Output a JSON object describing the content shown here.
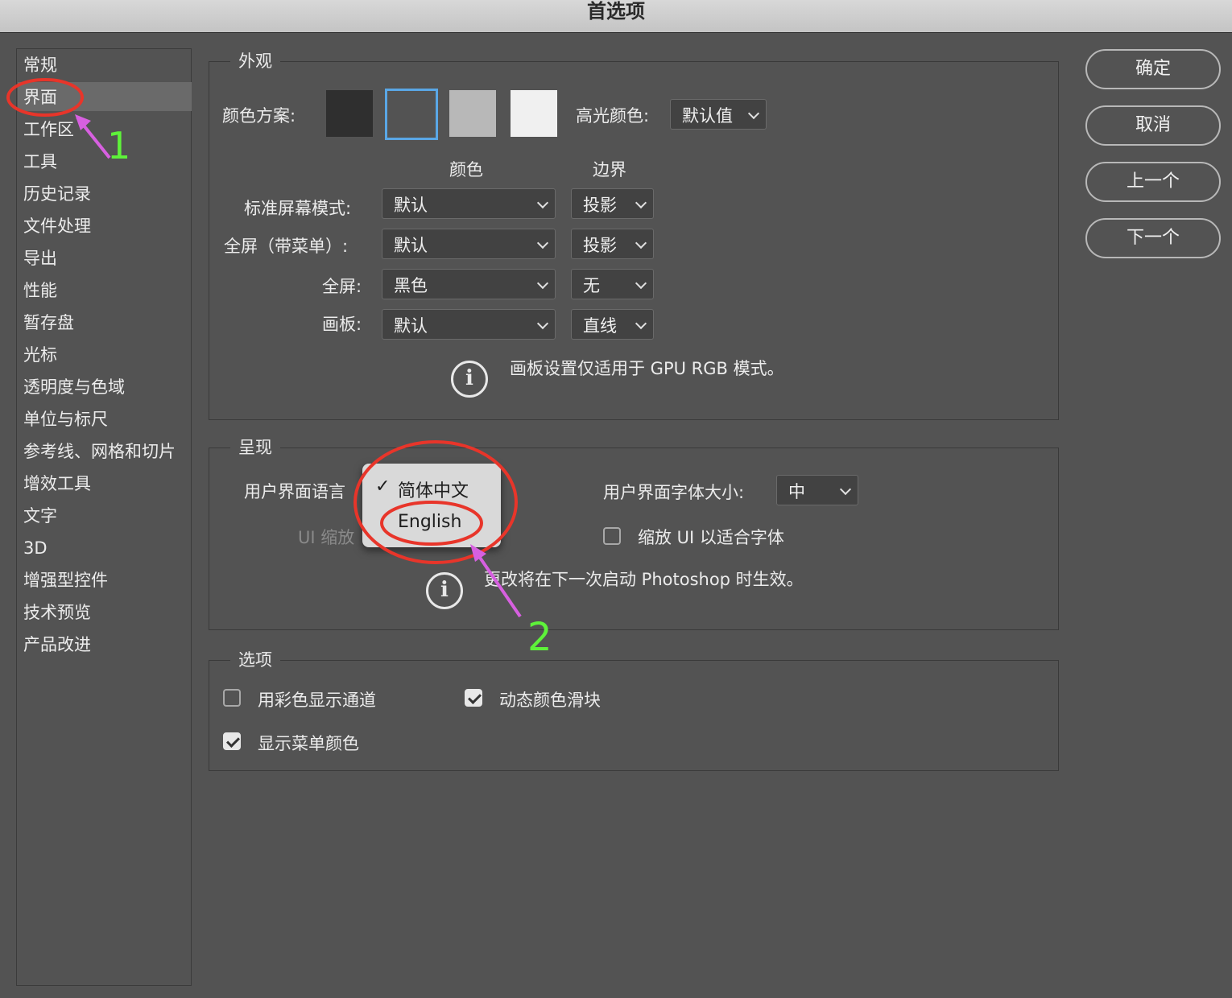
{
  "window": {
    "title": "首选项"
  },
  "sidebar": {
    "selected_index": 1,
    "items": [
      "常规",
      "界面",
      "工作区",
      "工具",
      "历史记录",
      "文件处理",
      "导出",
      "性能",
      "暂存盘",
      "光标",
      "透明度与色域",
      "单位与标尺",
      "参考线、网格和切片",
      "增效工具",
      "文字",
      "3D",
      "增强型控件",
      "技术预览",
      "产品改进"
    ]
  },
  "buttons": {
    "ok": "确定",
    "cancel": "取消",
    "prev": "上一个",
    "next": "下一个"
  },
  "appearance": {
    "legend": "外观",
    "color_scheme_label": "颜色方案:",
    "swatches": [
      "#2f2f2f",
      "#535353",
      "#b8b8b8",
      "#f0f0f0"
    ],
    "highlight_label": "高光颜色:",
    "highlight_value": "默认值",
    "col_color": "颜色",
    "col_border": "边界",
    "rows": [
      {
        "label": "标准屏幕模式:",
        "color": "默认",
        "border": "投影"
      },
      {
        "label": "全屏（带菜单）:",
        "color": "默认",
        "border": "投影"
      },
      {
        "label": "全屏:",
        "color": "黑色",
        "border": "无"
      },
      {
        "label": "画板:",
        "color": "默认",
        "border": "直线"
      }
    ],
    "note": "画板设置仅适用于 GPU RGB 模式。"
  },
  "presentation": {
    "legend": "呈现",
    "language_label": "用户界面语言",
    "ui_scale_label": "UI 缩放",
    "font_size_label": "用户界面字体大小:",
    "font_size_value": "中",
    "scale_to_font_label": "缩放 UI 以适合字体",
    "note": "更改将在下一次启动 Photoshop 时生效。",
    "language_menu": {
      "checked": "✓",
      "options": [
        "简体中文",
        "English"
      ]
    }
  },
  "options": {
    "legend": "选项",
    "color_channels": "用彩色显示通道",
    "dynamic_sliders": "动态颜色滑块",
    "menu_colors": "显示菜单颜色"
  },
  "annotations": {
    "step1": "1",
    "step2": "2",
    "circle_color": "#e8352a",
    "arrow_color": "#d760e0",
    "number_color": "#5ef23a"
  }
}
